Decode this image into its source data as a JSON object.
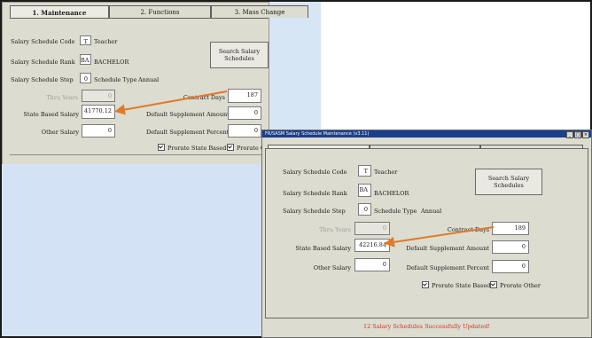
{
  "tabs": [
    "1. Maintenance",
    "2. Functions",
    "3. Mass Change"
  ],
  "background_form": {
    "code_label": "Salary Schedule Code",
    "code_value": "T",
    "code_name": "Teacher",
    "rank_label": "Salary Schedule Rank",
    "rank_value": "BA",
    "rank_name": "BACHELOR",
    "step_label": "Salary Schedule Step",
    "step_value": "0",
    "type_label": "Schedule Type",
    "type_value": "Annual",
    "search_button": "Search Salary Schedules",
    "thru_years_label": "Thru Years",
    "thru_years_value": "0",
    "contract_days_label": "Contract Days",
    "contract_days_value": "187",
    "state_based_label": "State Based Salary",
    "state_based_value": "41770.12",
    "default_supp_amount_label": "Default Supplement Amount",
    "default_supp_amount_value": "0",
    "other_salary_label": "Other Salary",
    "other_salary_value": "0",
    "default_supp_percent_label": "Default Supplement Percent",
    "default_supp_percent_value": "0",
    "prorate_state_label": "Prorate State Based",
    "prorate_other_label": "Prorate Other"
  },
  "foreground_window": {
    "title": "FR/SASM Salary Schedule Maintenance (v3.11)",
    "code_label": "Salary Schedule Code",
    "code_value": "T",
    "code_name": "Teacher",
    "rank_label": "Salary Schedule Rank",
    "rank_value": "BA",
    "rank_name": "BACHELOR",
    "step_label": "Salary Schedule Step",
    "step_value": "0",
    "type_label": "Schedule Type",
    "type_value": "Annual",
    "search_button": "Search Salary Schedules",
    "thru_years_label": "Thru Years",
    "thru_years_value": "0",
    "contract_days_label": "Contract Days",
    "contract_days_value": "189",
    "state_based_label": "State Based Salary",
    "state_based_value": "42216.84",
    "default_supp_amount_label": "Default Supplement Amount",
    "default_supp_amount_value": "0",
    "other_salary_label": "Other Salary",
    "other_salary_value": "0",
    "default_supp_percent_label": "Default Supplement Percent",
    "default_supp_percent_value": "0",
    "prorate_state_label": "Prorate State Based",
    "prorate_other_label": "Prorate Other",
    "status_message": "12 Salary Schedules Successfully Updated!"
  },
  "colors": {
    "arrow": "#e07a2a",
    "status_text": "#c43a2a",
    "titlebar": "#1c3f8c"
  }
}
